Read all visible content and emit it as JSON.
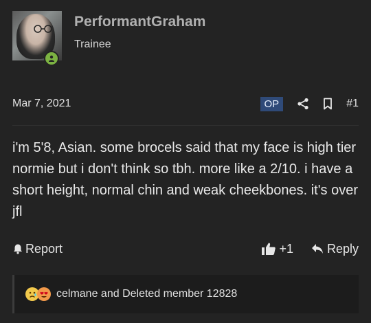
{
  "author": {
    "username": "PerformantGraham",
    "title": "Trainee",
    "status_color": "#7cb342"
  },
  "post": {
    "date": "Mar 7, 2021",
    "op_badge": "OP",
    "number": "#1",
    "message": "i'm 5'8, Asian. some brocels said that my face is high tier normie but i don't think so tbh. more like a 2/10. i have a short height, normal chin and weak cheekbones. it's over jfl"
  },
  "actions": {
    "report": "Report",
    "like_count": "+1",
    "reply": "Reply"
  },
  "reactions": {
    "icons": [
      "sad-emoji-icon",
      "heart-eyes-emoji-icon"
    ],
    "text": "celmane and Deleted member 12828"
  },
  "colors": {
    "background": "#232323",
    "op_badge": "#2f4a78"
  }
}
